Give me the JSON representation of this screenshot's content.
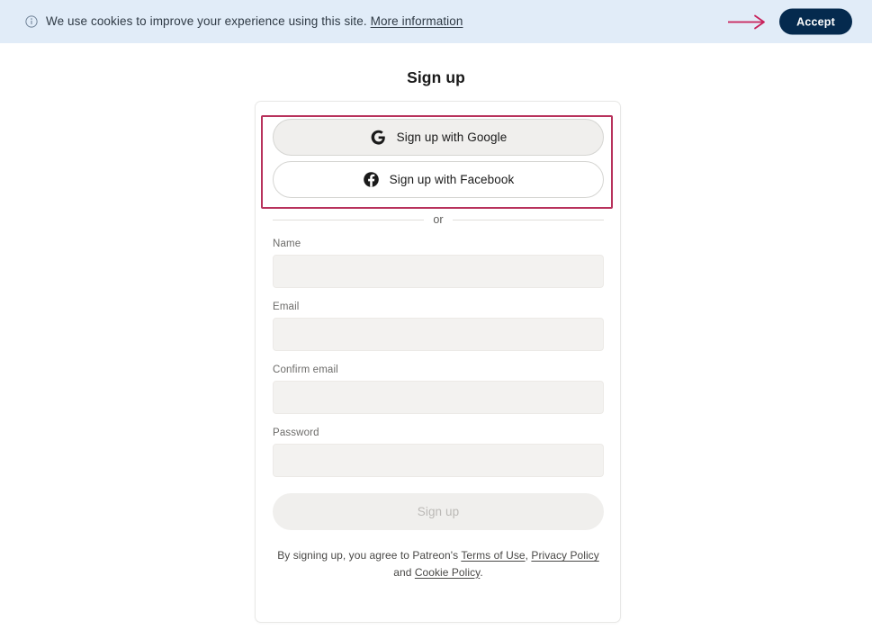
{
  "cookie_banner": {
    "icon": "info-circle-icon",
    "message": "We use cookies to improve your experience using this site.",
    "more_info_label": "More information",
    "accept_label": "Accept",
    "background_color": "#e1ecf8",
    "accept_bg_color": "#052a4e",
    "annotation_arrow_color": "#c8205a"
  },
  "page": {
    "title": "Sign up"
  },
  "social": {
    "highlight_color": "#b8325c",
    "buttons": [
      {
        "icon": "google-g-icon",
        "label": "Sign up with Google",
        "state": "hovered"
      },
      {
        "icon": "facebook-f-icon",
        "label": "Sign up with Facebook",
        "state": "default"
      }
    ]
  },
  "divider": {
    "label": "or"
  },
  "form": {
    "fields": [
      {
        "name": "name",
        "label": "Name",
        "value": "",
        "placeholder": ""
      },
      {
        "name": "email",
        "label": "Email",
        "value": "",
        "placeholder": ""
      },
      {
        "name": "confirm_email",
        "label": "Confirm email",
        "value": "",
        "placeholder": ""
      },
      {
        "name": "password",
        "label": "Password",
        "value": "",
        "placeholder": ""
      }
    ],
    "submit_label": "Sign up",
    "submit_state": "disabled"
  },
  "terms": {
    "prefix": "By signing up, you agree to Patreon's ",
    "terms_of_use": "Terms of Use",
    "comma": ", ",
    "privacy_policy": "Privacy Policy",
    "and": " and ",
    "cookie_policy": "Cookie Policy",
    "period": "."
  }
}
